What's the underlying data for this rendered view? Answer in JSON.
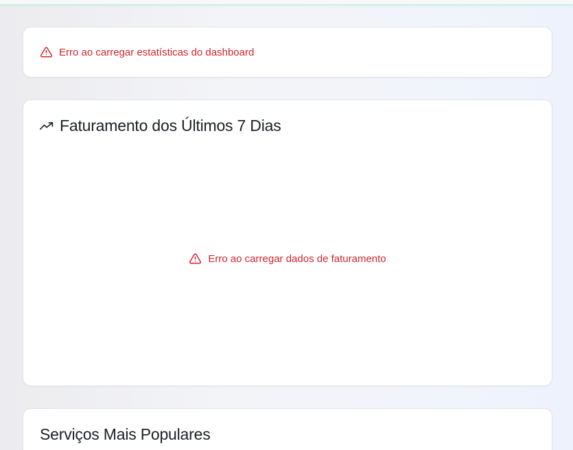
{
  "header": {
    "accent_color": "#c9ece0"
  },
  "stats_error": {
    "icon": "alert-triangle-icon",
    "message": "Erro ao carregar estatísticas do dashboard"
  },
  "revenue": {
    "icon": "trending-up-icon",
    "title": "Faturamento dos Últimos 7 Dias",
    "error": {
      "icon": "alert-triangle-icon",
      "message": "Erro ao carregar dados de faturamento"
    }
  },
  "services": {
    "title": "Serviços Mais Populares"
  },
  "colors": {
    "error": "#d3252c",
    "title": "#1c1f26",
    "card_border": "#e1e3e8"
  }
}
